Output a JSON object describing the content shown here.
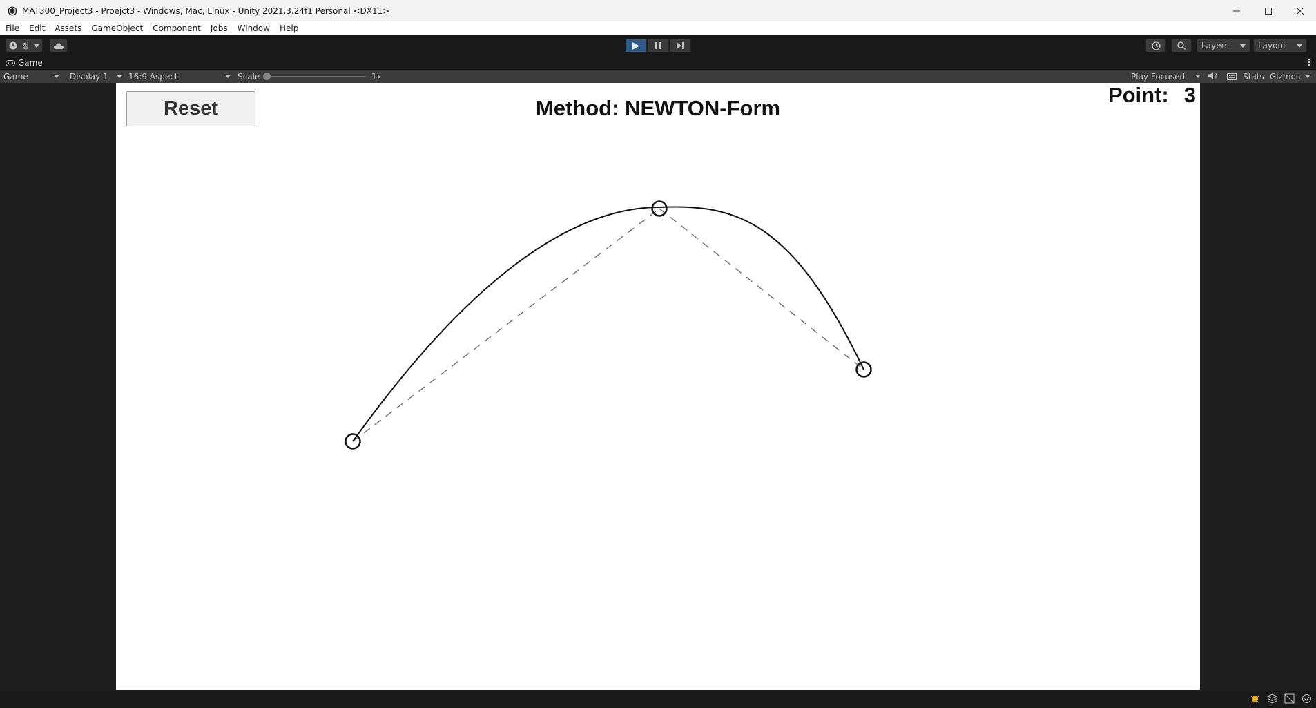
{
  "window": {
    "title": "MAT300_Project3 - Proejct3 - Windows, Mac, Linux - Unity 2021.3.24f1 Personal <DX11>"
  },
  "menu": [
    "File",
    "Edit",
    "Assets",
    "GameObject",
    "Component",
    "Jobs",
    "Window",
    "Help"
  ],
  "toolbar": {
    "account_label": "정",
    "layers_label": "Layers",
    "layout_label": "Layout"
  },
  "tab": {
    "label": "Game"
  },
  "gamebar": {
    "mode": "Game",
    "display": "Display 1",
    "aspect": "16:9 Aspect",
    "scale_label": "Scale",
    "scale_value": "1x",
    "play_focused": "Play Focused",
    "stats": "Stats",
    "gizmos": "Gizmos"
  },
  "game": {
    "reset_label": "Reset",
    "method_text": "Method: NEWTON-Form",
    "point_label": "Point:",
    "point_count": "3"
  },
  "colors": {
    "play_active": "#2f5b86",
    "editor_bg": "#191919"
  }
}
